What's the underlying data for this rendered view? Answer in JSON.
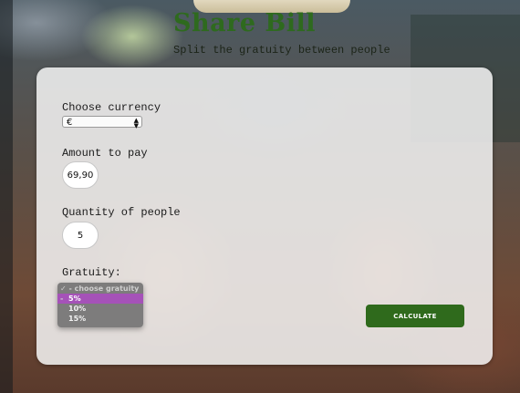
{
  "header": {
    "title": "Share Bill",
    "subtitle": "Split the gratuity between people"
  },
  "form": {
    "currency_label": "Choose currency",
    "currency_value": "€",
    "amount_label": "Amount to pay",
    "amount_value": "69,90",
    "people_label": "Quantity of people",
    "people_value": "5",
    "gratuity_label": "Gratuity:",
    "gratuity_options": [
      "✓ - choose gratuity -",
      "5%",
      "10%",
      "15%"
    ],
    "gratuity_selected": "5%",
    "calculate_label": "CALCULATE"
  },
  "colors": {
    "title": "#2e6a1e",
    "button": "#2f6a1c",
    "highlight": "#a552b8"
  }
}
